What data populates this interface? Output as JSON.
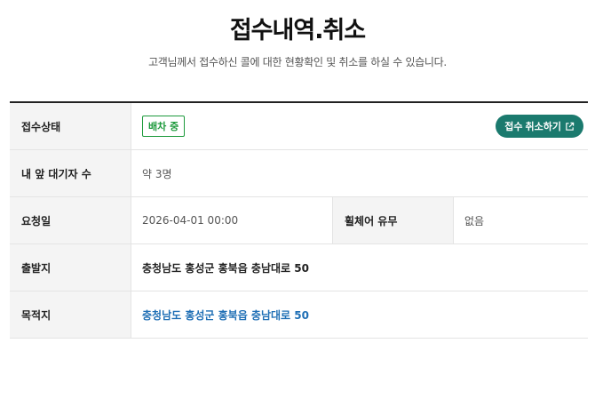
{
  "header": {
    "title": "접수내역.취소",
    "subtitle": "고객님께서 접수하신 콜에 대한 현황확인 및 취소를 하실 수 있습니다."
  },
  "table": {
    "status": {
      "label": "접수상태",
      "badge": "배차 중",
      "cancel_button": "접수 취소하기"
    },
    "waiting": {
      "label": "내 앞 대기자 수",
      "value": "약 3명"
    },
    "request": {
      "label": "요청일",
      "value": "2026-04-01 00:00",
      "wheelchair_label": "휠체어 유무",
      "wheelchair_value": "없음"
    },
    "departure": {
      "label": "출발지",
      "value": "충청남도 홍성군 홍북읍 충남대로 50"
    },
    "destination": {
      "label": "목적지",
      "value": "충청남도 홍성군 홍북읍 충남대로 50"
    }
  },
  "colors": {
    "badge_green": "#1d9a3c",
    "button_teal": "#1b7a6e",
    "link_blue": "#1f6fb5"
  },
  "icons": {
    "cancel_button_icon": "external-link-icon"
  }
}
